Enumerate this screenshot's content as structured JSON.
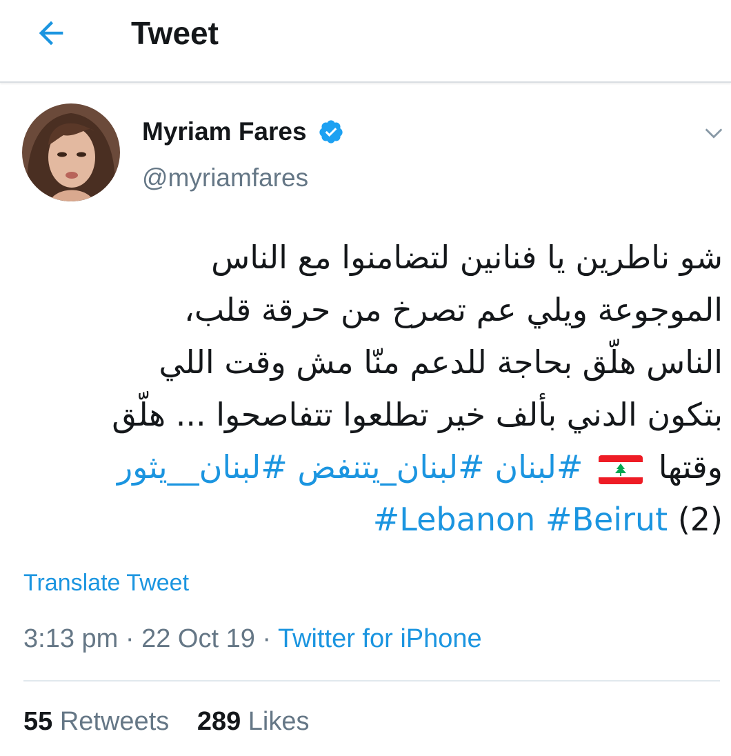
{
  "header": {
    "title": "Tweet",
    "back_icon": "arrow-left-icon"
  },
  "colors": {
    "accent": "#1b95e0",
    "secondary_text": "#657786",
    "divider": "#e1e8ed"
  },
  "tweet": {
    "author": {
      "name": "Myriam Fares",
      "handle": "@myriamfares",
      "verified": true
    },
    "text_lines": [
      "شو ناطرين يا فنانين لتضامنوا مع الناس",
      "الموجوعة ويلي عم تصرخ من حرقة قلب،",
      "الناس هلّق بحاجة للدعم منّا مش وقت اللي",
      "بتكون الدني بألف خير تطلعوا تتفاصحوا ... هلّق"
    ],
    "line5": {
      "word": "وقتها",
      "tags": [
        "#لبنان",
        "#لبنان_يتنفض",
        "#لبنان__يثور"
      ]
    },
    "line6": {
      "tag_lebanon": "#Lebanon",
      "tag_beirut": "#Beirut",
      "suffix": "(2)"
    },
    "translate_label": "Translate Tweet",
    "meta": {
      "time": "3:13 pm",
      "sep1": "·",
      "date": "22 Oct 19",
      "sep2": "·",
      "source": "Twitter for iPhone"
    },
    "stats": {
      "retweets_count": "55",
      "retweets_label": "Retweets",
      "likes_count": "289",
      "likes_label": "Likes"
    }
  }
}
